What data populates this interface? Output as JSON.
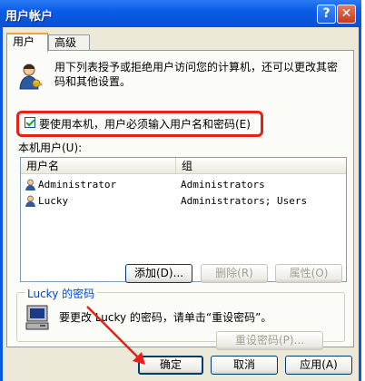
{
  "window": {
    "title": "用户帐户",
    "help_glyph": "?",
    "close_glyph": "✕"
  },
  "tabs": [
    {
      "label": "用户"
    },
    {
      "label": "高级"
    }
  ],
  "description": "用下列表授予或拒绝用户访问您的计算机，还可以更改其密码和其他设置。",
  "checkbox": {
    "label": "要使用本机，用户必须输入用户名和密码(E)",
    "checked": true
  },
  "users_label": "本机用户(U):",
  "list": {
    "headers": [
      "用户名",
      "组"
    ],
    "rows": [
      {
        "name": "Administrator",
        "group": "Administrators"
      },
      {
        "name": "Lucky",
        "group": "Administrators; Users"
      }
    ]
  },
  "list_buttons": {
    "add": "添加(D)...",
    "remove": "删除(R)",
    "properties": "属性(O)"
  },
  "password_group": {
    "title": "Lucky 的密码",
    "text": "要更改 Lucky 的密码，请单击“重设密码”。",
    "reset_button": "重设密码(P)..."
  },
  "footer": {
    "ok": "确定",
    "cancel": "取消",
    "apply": "应用(A)"
  },
  "colors": {
    "title_bar": "#0a5ce6",
    "annotation": "#e8201a",
    "dialog_bg": "#ece9d8"
  }
}
